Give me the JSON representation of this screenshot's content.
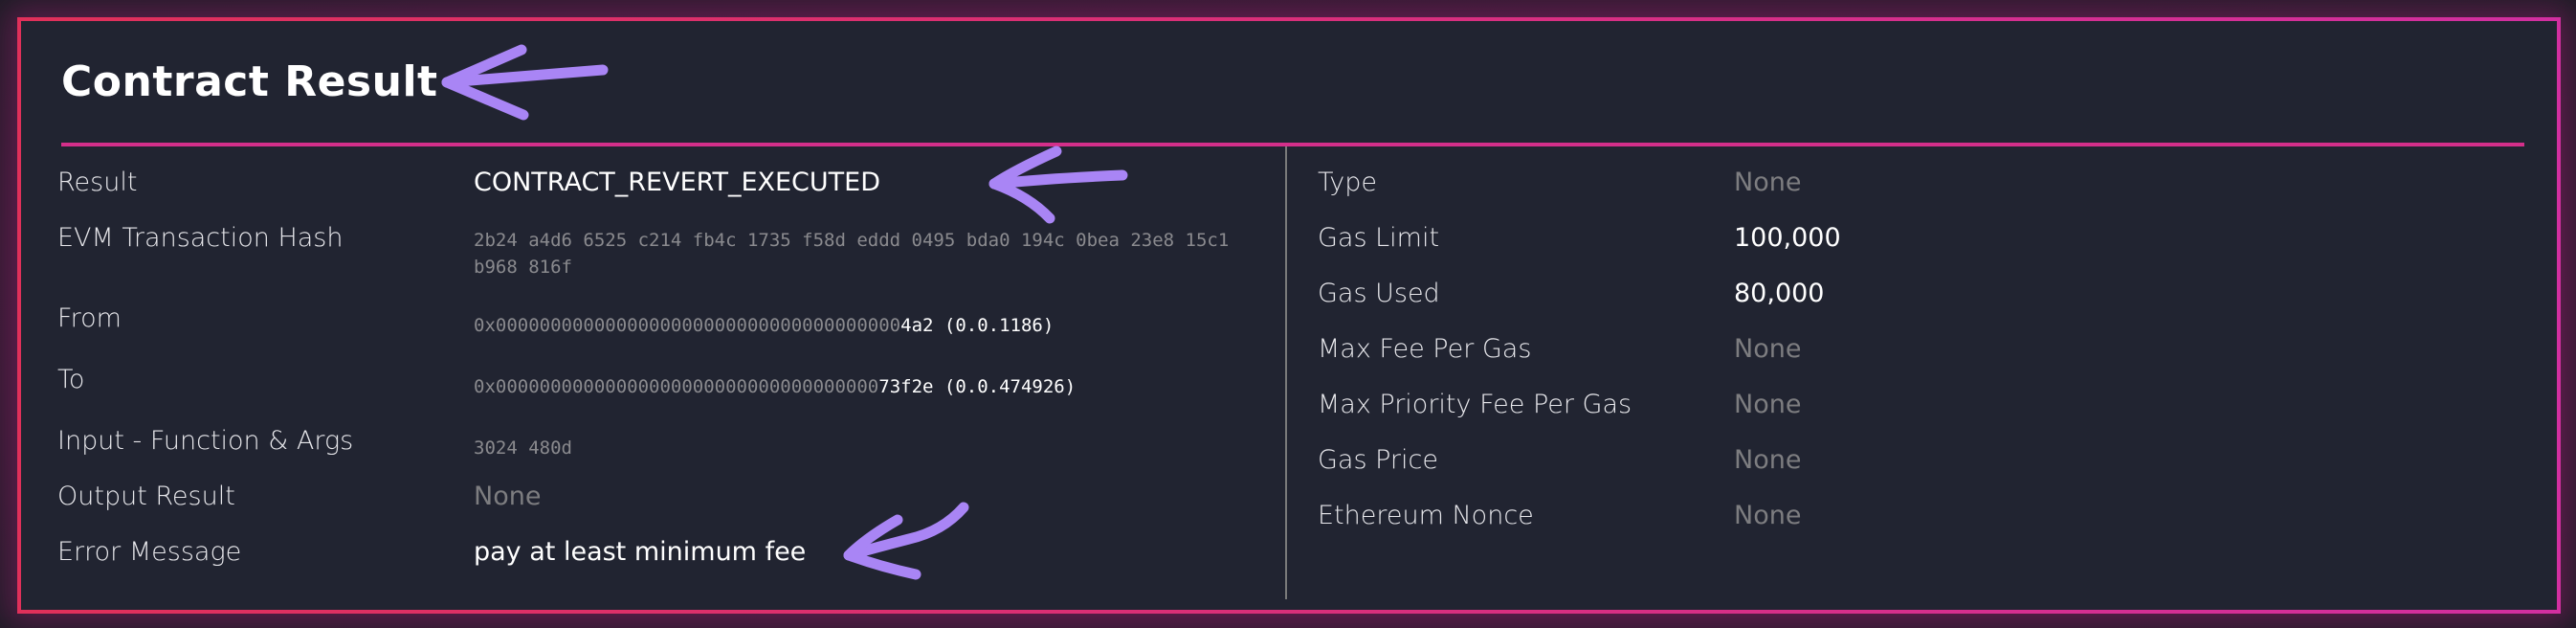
{
  "title": "Contract Result",
  "accent_colors": {
    "border_start": "#e0305a",
    "border_end": "#d22fa0",
    "divider": "#d42f8a",
    "annotation_arrow": "#a985f5"
  },
  "left_fields": [
    {
      "label": "Result",
      "value": "CONTRACT_REVERT_EXECUTED"
    },
    {
      "label": "EVM Transaction Hash",
      "value": "2b24 a4d6 6525 c214 fb4c 1735 f58d eddd 0495 bda0 194c 0bea 23e8 15c1 b968 816f"
    },
    {
      "label": "From",
      "value_prefix": "0x0000000000000000000000000000000000000",
      "value_highlight": "4a2",
      "value_suffix": "(0.0.1186)"
    },
    {
      "label": "To",
      "value_prefix": "0x00000000000000000000000000000000000",
      "value_highlight": "73f2e",
      "value_suffix": "(0.0.474926)"
    },
    {
      "label": "Input - Function & Args",
      "value": "3024 480d"
    },
    {
      "label": "Output Result",
      "value": "None"
    },
    {
      "label": "Error Message",
      "value": "pay at least minimum fee"
    }
  ],
  "right_fields": [
    {
      "label": "Type",
      "value": "None"
    },
    {
      "label": "Gas Limit",
      "value": "100,000"
    },
    {
      "label": "Gas Used",
      "value": "80,000"
    },
    {
      "label": "Max Fee Per Gas",
      "value": "None"
    },
    {
      "label": "Max Priority Fee Per Gas",
      "value": "None"
    },
    {
      "label": "Gas Price",
      "value": "None"
    },
    {
      "label": "Ethereum Nonce",
      "value": "None"
    }
  ],
  "annotations": [
    {
      "name": "arrow-pointing-title",
      "target": "title"
    },
    {
      "name": "arrow-pointing-result",
      "target": "Result"
    },
    {
      "name": "arrow-pointing-error-message",
      "target": "Error Message"
    }
  ]
}
